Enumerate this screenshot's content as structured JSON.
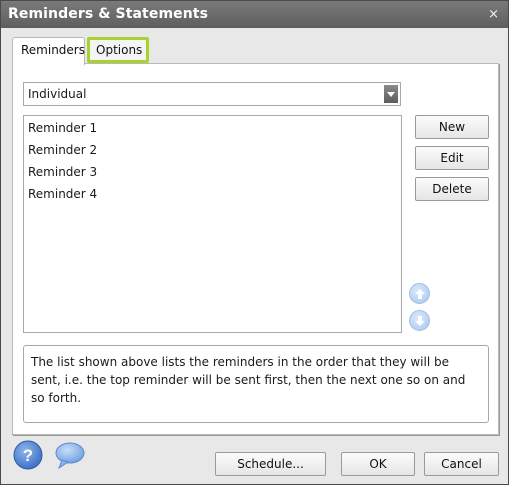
{
  "window": {
    "title": "Reminders & Statements",
    "close_glyph": "×"
  },
  "tabs": [
    {
      "label": "Reminders",
      "active": true
    },
    {
      "label": "Options",
      "highlighted": true
    }
  ],
  "dropdown": {
    "selected": "Individual"
  },
  "reminders": [
    "Reminder 1",
    "Reminder 2",
    "Reminder 3",
    "Reminder 4"
  ],
  "side_buttons": {
    "new": "New",
    "edit": "Edit",
    "delete": "Delete"
  },
  "description": "The list shown above lists the reminders in the order that they will be sent, i.e. the top reminder will be sent first, then the next one so on and so forth.",
  "footer": {
    "schedule": "Schedule...",
    "ok": "OK",
    "cancel": "Cancel"
  },
  "icons": {
    "close": "close-icon",
    "dropdown": "chevron-down-icon",
    "move_up": "arrow-up-icon",
    "move_down": "arrow-down-icon",
    "help": "help-icon",
    "feedback": "chat-icon"
  },
  "colors": {
    "titlebar": "#6b6b6b",
    "tab_highlight": "#a8d22d",
    "arrow_blue": "#a6c6f0"
  }
}
